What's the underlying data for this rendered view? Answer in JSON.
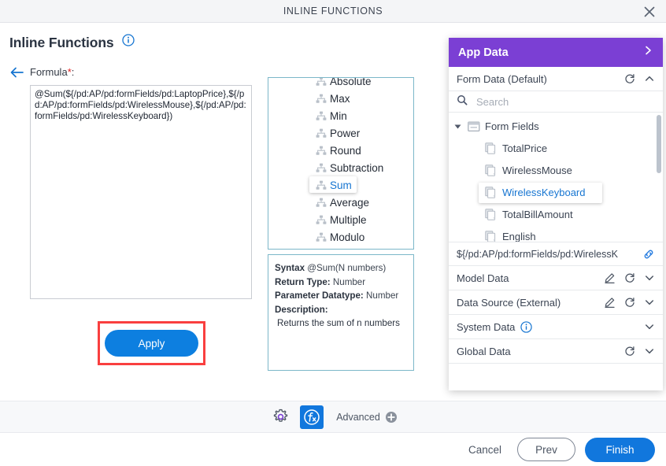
{
  "window": {
    "title": "INLINE FUNCTIONS",
    "close_icon": "close-icon"
  },
  "page": {
    "heading": "Inline Functions",
    "info_icon": "info-icon",
    "back_icon": "back-arrow-icon"
  },
  "formula": {
    "label": "Formula",
    "required_mark": "*",
    "colon": ":",
    "value": "@Sum(${/pd:AP/pd:formFields/pd:LaptopPrice},${/pd:AP/pd:formFields/pd:WirelessMouse},${/pd:AP/pd:formFields/pd:WirelessKeyboard})",
    "apply_label": "Apply",
    "highlight_color": "#f93f3f"
  },
  "functions": {
    "items": [
      {
        "label": "Absolute",
        "selected": false
      },
      {
        "label": "Max",
        "selected": false
      },
      {
        "label": "Min",
        "selected": false
      },
      {
        "label": "Power",
        "selected": false
      },
      {
        "label": "Round",
        "selected": false
      },
      {
        "label": "Subtraction",
        "selected": false
      },
      {
        "label": "Sum",
        "selected": true
      },
      {
        "label": "Average",
        "selected": false
      },
      {
        "label": "Multiple",
        "selected": false
      },
      {
        "label": "Modulo",
        "selected": false
      }
    ]
  },
  "syntax": {
    "syntax_label": "Syntax",
    "syntax_value": "@Sum(N numbers)",
    "return_label": "Return Type:",
    "return_value": "Number",
    "param_label": "Parameter Datatype:",
    "param_value": "Number",
    "description_label": "Description:",
    "description_value": "Returns the sum of n numbers"
  },
  "sidebar": {
    "header": {
      "title": "App Data",
      "collapse_icon": "chevron-right-icon"
    },
    "form_data": {
      "label": "Form Data (Default)",
      "refresh_icon": "refresh-icon",
      "chevron_icon": "chevron-up-icon"
    },
    "search": {
      "placeholder": "Search",
      "value": "",
      "icon": "search-icon"
    },
    "tree": {
      "root_label": "Form Fields",
      "root_icon": "folder-icon",
      "caret_icon": "caret-down-icon",
      "leaves": [
        {
          "label": "TotalPrice",
          "selected": false
        },
        {
          "label": "WirelessMouse",
          "selected": false
        },
        {
          "label": "WirelessKeyboard",
          "selected": true
        },
        {
          "label": "TotalBillAmount",
          "selected": false
        },
        {
          "label": "English",
          "selected": false
        }
      ]
    },
    "path": {
      "value": "${/pd:AP/pd:formFields/pd:WirelessK",
      "link_icon": "link-icon"
    },
    "sections": [
      {
        "label": "Model Data",
        "edit_icon": "pencil-icon",
        "refresh_icon": "refresh-icon",
        "chevron_icon": "chevron-down-icon",
        "has_edit": true,
        "has_refresh": true,
        "has_info": false
      },
      {
        "label": "Data Source (External)",
        "edit_icon": "pencil-icon",
        "refresh_icon": "refresh-icon",
        "chevron_icon": "chevron-down-icon",
        "has_edit": true,
        "has_refresh": true,
        "has_info": false
      },
      {
        "label": "System Data",
        "info_icon": "info-icon",
        "chevron_icon": "chevron-down-icon",
        "has_edit": false,
        "has_refresh": false,
        "has_info": true
      },
      {
        "label": "Global Data",
        "refresh_icon": "refresh-icon",
        "chevron_icon": "chevron-down-icon",
        "has_edit": false,
        "has_refresh": true,
        "has_info": false
      }
    ],
    "accent_color": "#7b3fd4"
  },
  "toolbar": {
    "gear_icon": "gear-icon",
    "fx_icon": "function-fx-icon",
    "advanced_label": "Advanced",
    "add_icon": "plus-circle-icon",
    "fx_active_color": "#1177dd"
  },
  "footer": {
    "cancel_label": "Cancel",
    "prev_label": "Prev",
    "finish_label": "Finish",
    "primary_color": "#1177dd"
  }
}
